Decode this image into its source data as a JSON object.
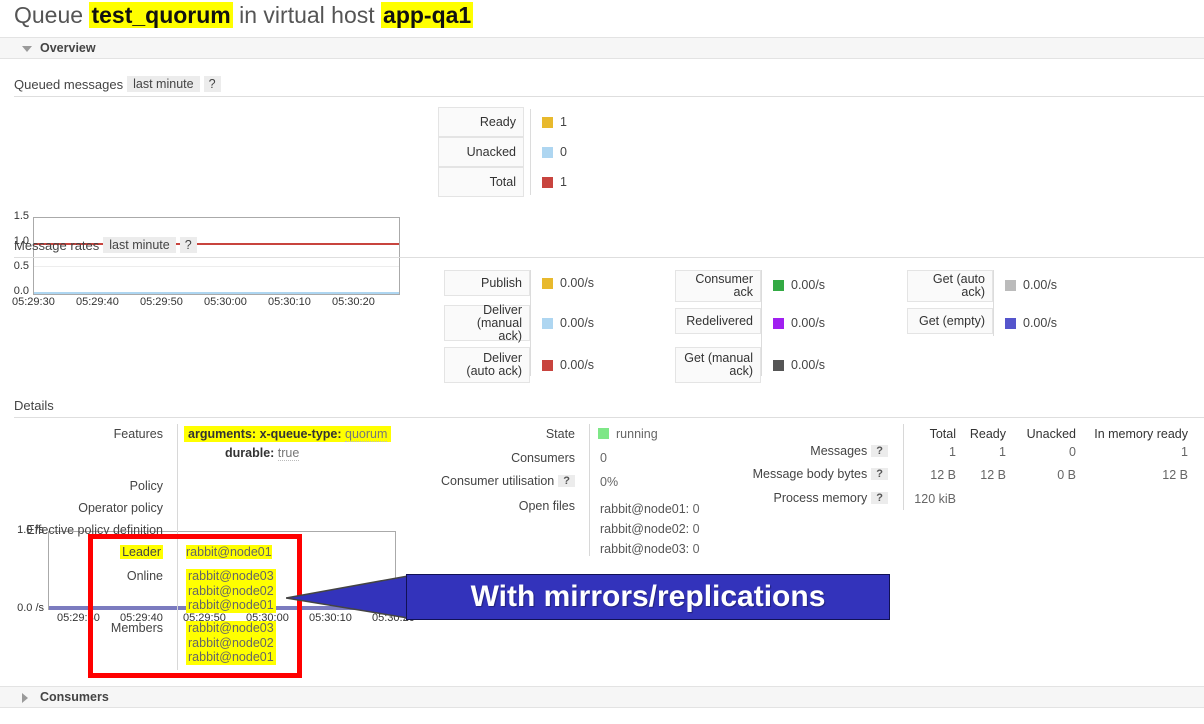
{
  "page": {
    "title_prefix": "Queue",
    "queue_name": "test_quorum",
    "title_middle": "in virtual host",
    "vhost": "app-qa1"
  },
  "overview_section": {
    "label": "Overview",
    "expanded": true
  },
  "consumers_section": {
    "label": "Consumers",
    "expanded": false
  },
  "queued_messages": {
    "heading": "Queued messages",
    "period": "last minute",
    "help": "?",
    "legend": [
      {
        "label": "Ready",
        "value": "1",
        "color": "#e8b92d"
      },
      {
        "label": "Unacked",
        "value": "0",
        "color": "#aed6f1"
      },
      {
        "label": "Total",
        "value": "1",
        "color": "#c8443e"
      }
    ]
  },
  "message_rates": {
    "heading": "Message rates",
    "period": "last minute",
    "help": "?",
    "legend_col1": [
      {
        "label": "Publish",
        "value": "0.00/s",
        "color": "#e8b92d"
      },
      {
        "label": "Deliver (manual ack)",
        "value": "0.00/s",
        "color": "#aed6f1"
      },
      {
        "label": "Deliver (auto ack)",
        "value": "0.00/s",
        "color": "#c8443e"
      }
    ],
    "legend_col2": [
      {
        "label": "Consumer ack",
        "value": "0.00/s",
        "color": "#33aa44"
      },
      {
        "label": "Redelivered",
        "value": "0.00/s",
        "color": "#a020f0"
      },
      {
        "label": "Get (manual ack)",
        "value": "0.00/s",
        "color": "#555555"
      }
    ],
    "legend_col3": [
      {
        "label": "Get (auto ack)",
        "value": "0.00/s",
        "color": "#bbbbbb"
      },
      {
        "label": "Get (empty)",
        "value": "0.00/s",
        "color": "#5555cc"
      }
    ]
  },
  "chart_data": [
    {
      "type": "line",
      "title": "Queued messages",
      "xlabel": "",
      "ylabel": "",
      "ylim": [
        0.0,
        1.5
      ],
      "yticks": [
        "0.0",
        "0.5",
        "1.0",
        "1.5"
      ],
      "x": [
        "05:29:30",
        "05:29:40",
        "05:29:50",
        "05:30:00",
        "05:30:10",
        "05:30:20"
      ],
      "grid": true,
      "legend_position": "right",
      "series": [
        {
          "name": "Ready",
          "color": "#e8b92d",
          "values": [
            1,
            1,
            1,
            1,
            1,
            1
          ],
          "hidden_behind_total": true
        },
        {
          "name": "Unacked",
          "color": "#aed6f1",
          "values": [
            0,
            0,
            0,
            0,
            0,
            0
          ]
        },
        {
          "name": "Total",
          "color": "#c8443e",
          "values": [
            1,
            1,
            1,
            1,
            1,
            1
          ]
        }
      ]
    },
    {
      "type": "line",
      "title": "Message rates",
      "xlabel": "",
      "ylabel": "/s",
      "ylim": [
        0.0,
        1.0
      ],
      "yticks": [
        "0.0 /s",
        "1.0 /s"
      ],
      "x": [
        "05:29:30",
        "05:29:40",
        "05:29:50",
        "05:30:00",
        "05:30:10",
        "05:30:20"
      ],
      "grid": false,
      "legend_position": "right",
      "series": [
        {
          "name": "Publish",
          "color": "#e8b92d",
          "values": [
            0,
            0,
            0,
            0,
            0,
            0
          ]
        },
        {
          "name": "Deliver (manual ack)",
          "color": "#aed6f1",
          "values": [
            0,
            0,
            0,
            0,
            0,
            0
          ]
        },
        {
          "name": "Deliver (auto ack)",
          "color": "#c8443e",
          "values": [
            0,
            0,
            0,
            0,
            0,
            0
          ]
        },
        {
          "name": "Consumer ack",
          "color": "#33aa44",
          "values": [
            0,
            0,
            0,
            0,
            0,
            0
          ]
        },
        {
          "name": "Redelivered",
          "color": "#a020f0",
          "values": [
            0,
            0,
            0,
            0,
            0,
            0
          ]
        },
        {
          "name": "Get (manual ack)",
          "color": "#555555",
          "values": [
            0,
            0,
            0,
            0,
            0,
            0
          ]
        },
        {
          "name": "Get (auto ack)",
          "color": "#bbbbbb",
          "values": [
            0,
            0,
            0,
            0,
            0,
            0
          ]
        },
        {
          "name": "Get (empty)",
          "color": "#5555cc",
          "values": [
            0,
            0,
            0,
            0,
            0,
            0
          ]
        }
      ]
    }
  ],
  "details": {
    "heading": "Details",
    "features": {
      "label": "Features",
      "arguments_key": "arguments:",
      "arg_name": "x-queue-type:",
      "arg_value": "quorum",
      "durable_key": "durable:",
      "durable_value": "true"
    },
    "policy_label": "Policy",
    "operator_policy_label": "Operator policy",
    "effective_policy_label": "Effective policy definition",
    "leader_label": "Leader",
    "leader_value": "rabbit@node01",
    "online_label": "Online",
    "online_values": [
      "rabbit@node03",
      "rabbit@node02",
      "rabbit@node01"
    ],
    "members_label": "Members",
    "members_values": [
      "rabbit@node03",
      "rabbit@node02",
      "rabbit@node01"
    ],
    "state_label": "State",
    "state_value": "running",
    "consumers_label": "Consumers",
    "consumers_value": "0",
    "consumer_utilisation_label": "Consumer utilisation",
    "consumer_utilisation_help": "?",
    "consumer_utilisation_value": "0%",
    "open_files_label": "Open files",
    "open_files": [
      {
        "node": "rabbit@node01:",
        "value": "0"
      },
      {
        "node": "rabbit@node02:",
        "value": "0"
      },
      {
        "node": "rabbit@node03:",
        "value": "0"
      }
    ],
    "stats_headers": [
      "Total",
      "Ready",
      "Unacked",
      "In memory ready"
    ],
    "stats_rows": [
      {
        "label": "Messages",
        "help": "?",
        "cells": [
          "1",
          "1",
          "0",
          "1"
        ]
      },
      {
        "label": "Message body bytes",
        "help": "?",
        "cells": [
          "12 B",
          "12 B",
          "0 B",
          "12 B"
        ]
      },
      {
        "label": "Process memory",
        "help": "?",
        "cells": [
          "120 kiB",
          "",
          "",
          ""
        ]
      }
    ]
  },
  "annotation": {
    "callout_text": "With mirrors/replications",
    "callout_bg": "#3333bb",
    "callout_fg": "#ffffff",
    "box_color": "#ff0000"
  }
}
